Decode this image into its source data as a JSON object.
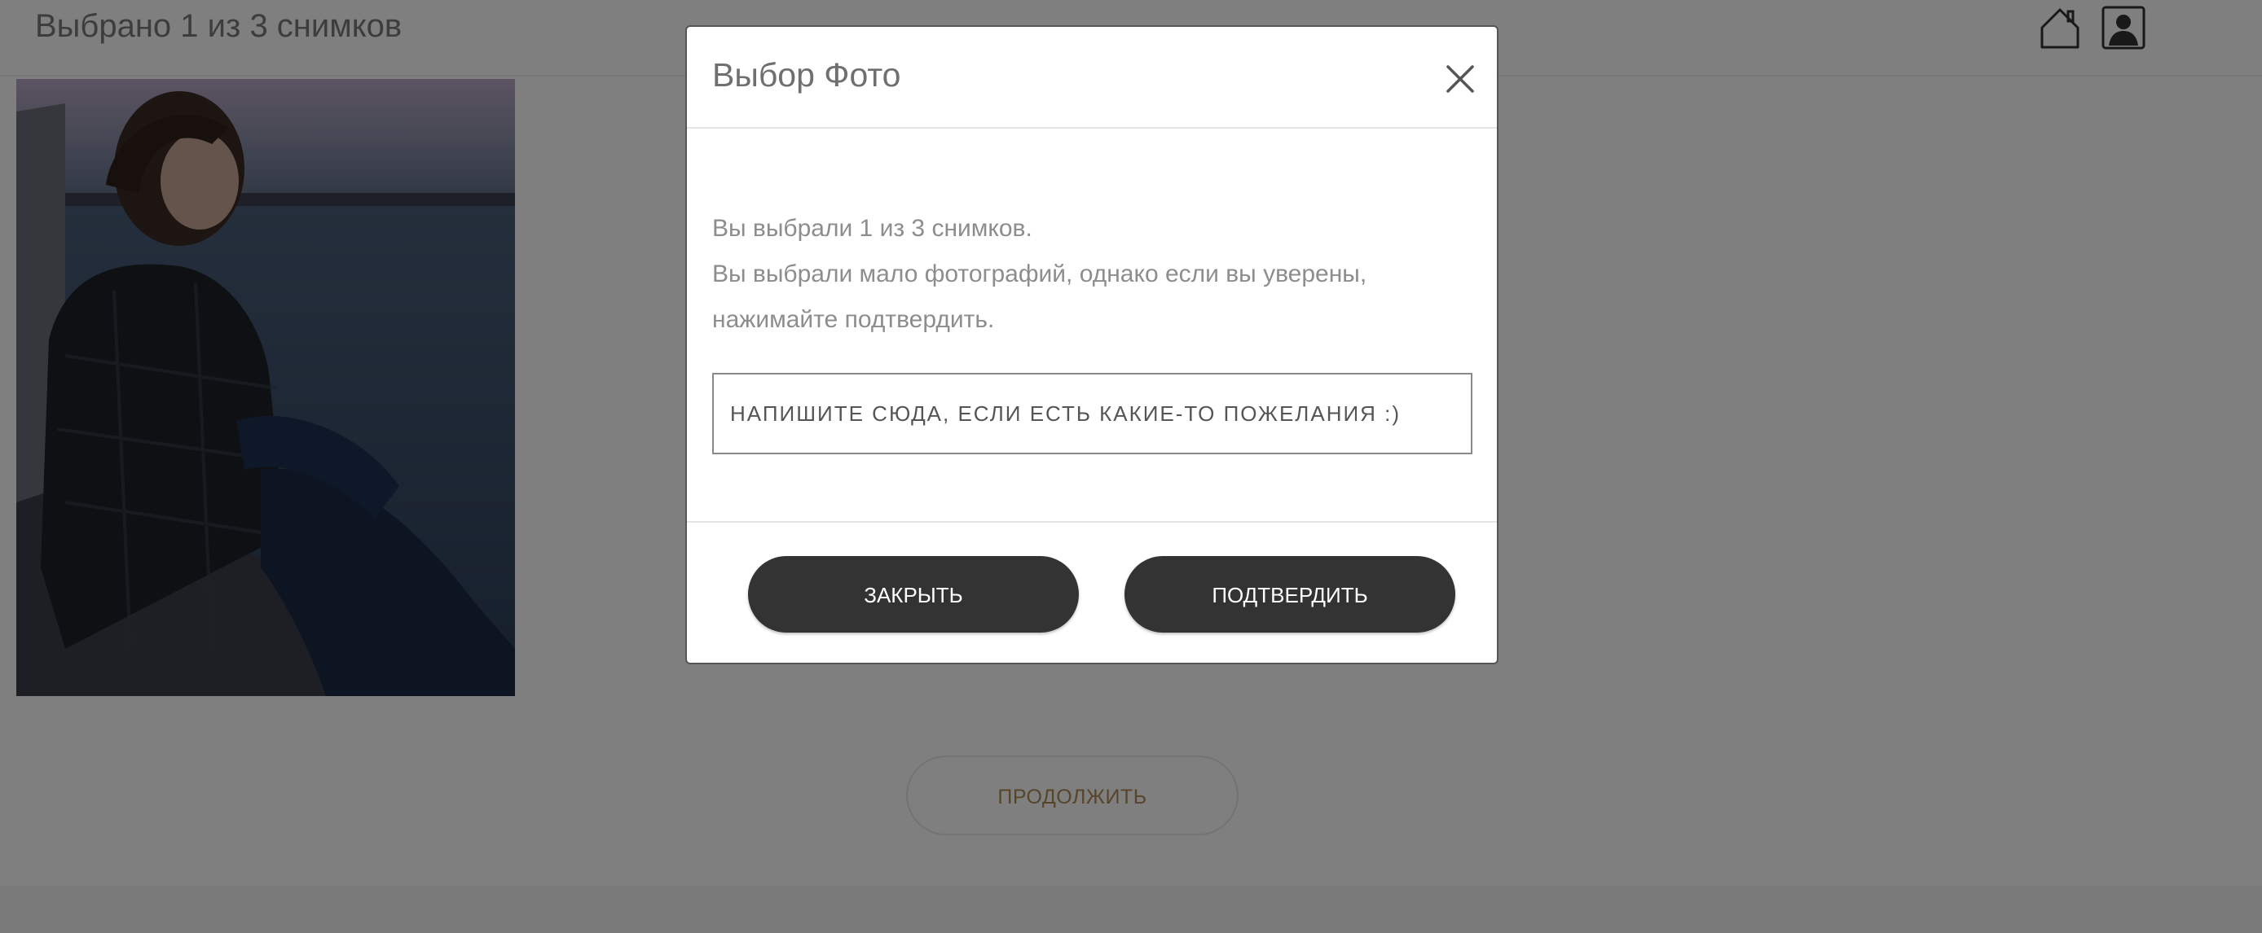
{
  "header": {
    "title": "Выбрано 1 из 3 снимков",
    "home_icon": "home-icon",
    "profile_icon": "user-profile-icon"
  },
  "gallery": {
    "photo_description": "selected-photo"
  },
  "continue_button": {
    "label": "ПРОДОЛЖИТЬ"
  },
  "modal": {
    "title": "Выбор Фото",
    "close_icon": "close-icon",
    "message_lines": [
      "Вы выбрали 1 из 3 снимков.",
      "Вы выбрали мало фотографий, однако если вы уверены,",
      "нажимайте подтвердить."
    ],
    "wish_input": {
      "value": "",
      "placeholder": "НАПИШИТЕ СЮДА, ЕСЛИ ЕСТЬ КАКИЕ-ТО ПОЖЕЛАНИЯ :)"
    },
    "close_button_label": "ЗАКРЫТЬ",
    "confirm_button_label": "ПОДТВЕРДИТЬ"
  },
  "colors": {
    "overlay": "#000000",
    "button_dark": "#333333",
    "continue_text": "#b08a50"
  }
}
